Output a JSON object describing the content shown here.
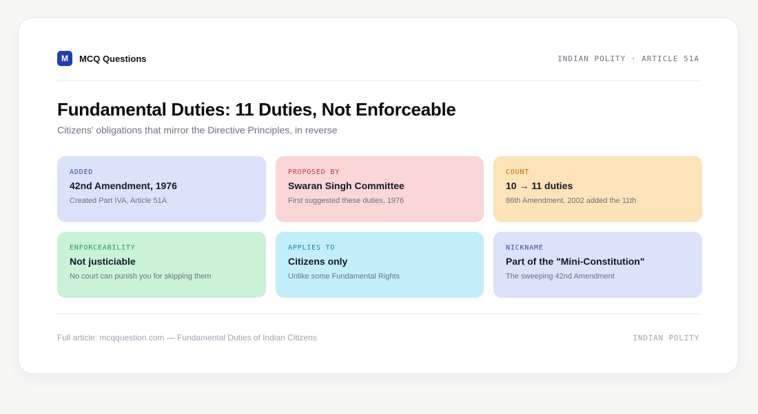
{
  "brand": {
    "logo_letter": "M",
    "name": "MCQ Questions"
  },
  "header": {
    "tag": "INDIAN POLITY · ARTICLE 51A"
  },
  "title": "Fundamental Duties: 11 Duties, Not Enforceable",
  "subtitle": "Citizens' obligations that mirror the Directive Principles, in reverse",
  "tiles": [
    {
      "label": "ADDED",
      "value": "42nd Amendment, 1976",
      "note": "Created Part IVA, Article 51A",
      "bg": "#dbe3fb",
      "label_color": "#3b4a9a"
    },
    {
      "label": "PROPOSED BY",
      "value": "Swaran Singh Committee",
      "note": "First suggested these duties, 1976",
      "bg": "#fad6d6",
      "label_color": "#c2373a"
    },
    {
      "label": "COUNT",
      "value": "10 → 11 duties",
      "note": "86th Amendment, 2002 added the 11th",
      "bg": "#fce3b8",
      "label_color": "#c2700b"
    },
    {
      "label": "ENFORCEABILITY",
      "value": "Not justiciable",
      "note": "No court can punish you for skipping them",
      "bg": "#c9f2d6",
      "label_color": "#1f9d55"
    },
    {
      "label": "APPLIES TO",
      "value": "Citizens only",
      "note": "Unlike some Fundamental Rights",
      "bg": "#c2eefa",
      "label_color": "#0e8aa3"
    },
    {
      "label": "NICKNAME",
      "value": "Part of the \"Mini-Constitution\"",
      "note": "The sweeping 42nd Amendment",
      "bg": "#dbe3fb",
      "label_color": "#3b4a9a"
    }
  ],
  "footer": {
    "source": "Full article: mcqquestion.com — Fundamental Duties of Indian Citizens",
    "tag": "INDIAN POLITY"
  }
}
